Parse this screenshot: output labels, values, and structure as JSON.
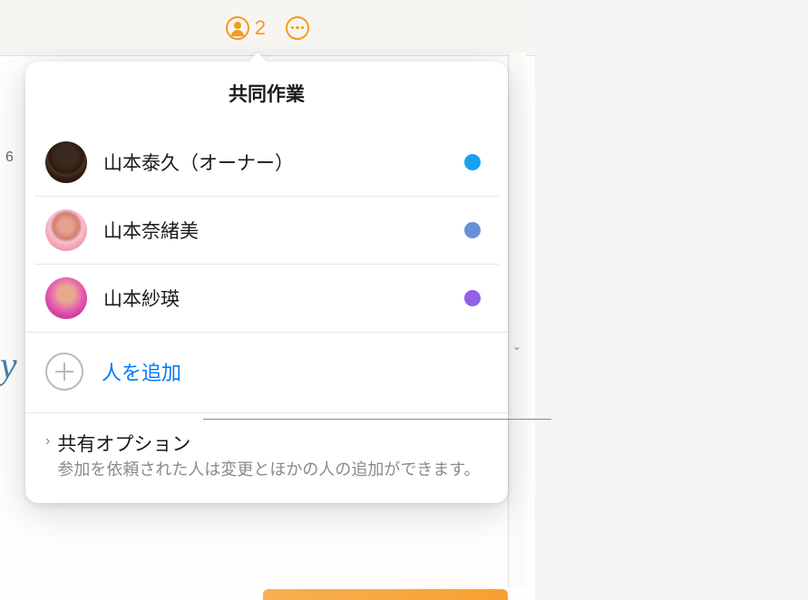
{
  "toolbar": {
    "collab_count": "2"
  },
  "popover": {
    "title": "共同作業",
    "people": [
      {
        "name": "山本泰久（オーナー）",
        "dot_color": "dot-blue"
      },
      {
        "name": "山本奈緒美",
        "dot_color": "dot-lightblue"
      },
      {
        "name": "山本紗瑛",
        "dot_color": "dot-purple"
      }
    ],
    "add_label": "人を追加",
    "options_title": "共有オプション",
    "options_desc": "参加を依頼された人は変更とほかの人の追加ができます。"
  },
  "background": {
    "left_text": "6",
    "cursive_hint": "y"
  }
}
